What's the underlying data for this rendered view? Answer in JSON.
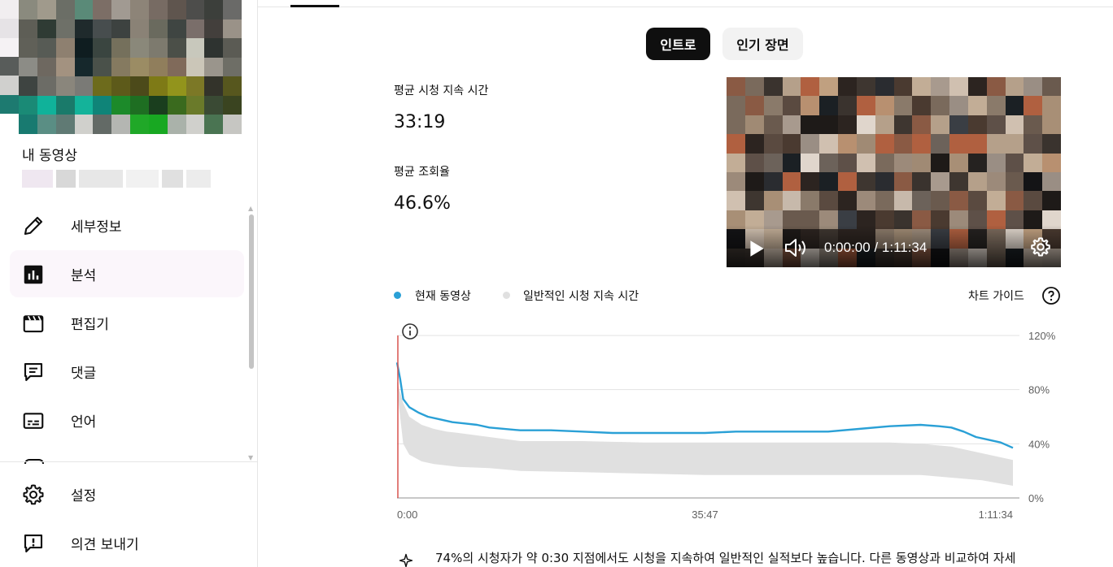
{
  "sidebar": {
    "channel_title": "내 동영상",
    "items": [
      {
        "label": "세부정보",
        "icon": "pencil-icon"
      },
      {
        "label": "분석",
        "icon": "analytics-icon",
        "active": true
      },
      {
        "label": "편집기",
        "icon": "clapperboard-icon"
      },
      {
        "label": "댓글",
        "icon": "comment-icon"
      },
      {
        "label": "언어",
        "icon": "subtitles-icon"
      }
    ],
    "footer_items": [
      {
        "label": "설정",
        "icon": "gear-icon"
      },
      {
        "label": "의견 보내기",
        "icon": "feedback-icon"
      }
    ]
  },
  "tabs": {
    "intro_label": "인트로",
    "popular_label": "인기 장면",
    "selected": "인트로"
  },
  "metrics": {
    "avg_view_duration_label": "평균 시청 지속 시간",
    "avg_view_duration_value": "33:19",
    "avg_percentage_label": "평균 조회율",
    "avg_percentage_value": "46.6%"
  },
  "player": {
    "time_display": "0:00:00 / 1:11:34",
    "played_fraction": 0
  },
  "legend": {
    "current_label": "현재 동영상",
    "typical_label": "일반적인 시청 지속 시간",
    "chart_guide_label": "차트 가이드"
  },
  "colors": {
    "current_series": "#2aa0d6",
    "typical_band": "#e0e0e0",
    "marker_line": "#d9534f",
    "accent_dark": "#0f0f0f"
  },
  "chart_data": {
    "type": "line",
    "ylim": [
      0,
      120
    ],
    "yticks": [
      "120%",
      "80%",
      "40%",
      "0%"
    ],
    "ytick_values": [
      120,
      80,
      40,
      0
    ],
    "xticks": [
      "0:00",
      "35:47",
      "1:11:34"
    ],
    "xtick_values": [
      0,
      0.5,
      1
    ],
    "series": [
      {
        "name": "현재 동영상",
        "x": [
          0,
          0.005,
          0.01,
          0.02,
          0.035,
          0.05,
          0.07,
          0.09,
          0.11,
          0.13,
          0.15,
          0.2,
          0.25,
          0.3,
          0.35,
          0.4,
          0.45,
          0.5,
          0.55,
          0.6,
          0.65,
          0.7,
          0.75,
          0.8,
          0.85,
          0.88,
          0.9,
          0.92,
          0.94,
          0.96,
          0.98,
          1.0
        ],
        "y": [
          100,
          88,
          73,
          67,
          63,
          60,
          58,
          56,
          55,
          54,
          52,
          50,
          50,
          49,
          48,
          48,
          48,
          48,
          49,
          49,
          49,
          49,
          51,
          53,
          54,
          53,
          52,
          49,
          45,
          43,
          41,
          37
        ]
      },
      {
        "name": "일반적인 시청 지속 시간",
        "x": [
          0,
          0.01,
          0.02,
          0.04,
          0.06,
          0.08,
          0.1,
          0.15,
          0.2,
          0.3,
          0.4,
          0.5,
          0.6,
          0.7,
          0.8,
          0.85,
          0.9,
          0.95,
          1.0
        ],
        "upper": [
          86,
          70,
          60,
          54,
          51,
          49,
          48,
          45,
          42,
          42,
          41,
          41,
          41,
          41,
          41,
          40,
          38,
          33,
          28
        ],
        "lower": [
          80,
          40,
          32,
          27,
          25,
          24,
          23,
          22,
          20,
          19,
          18,
          17,
          17,
          17,
          17,
          17,
          15,
          13,
          9
        ]
      }
    ]
  },
  "insight": {
    "text": "74%의 시청자가 약 0:30 지점에서도 시청을 지속하여 일반적인 실적보다 높습니다. 다른 동영상과 비교하여 자세"
  }
}
